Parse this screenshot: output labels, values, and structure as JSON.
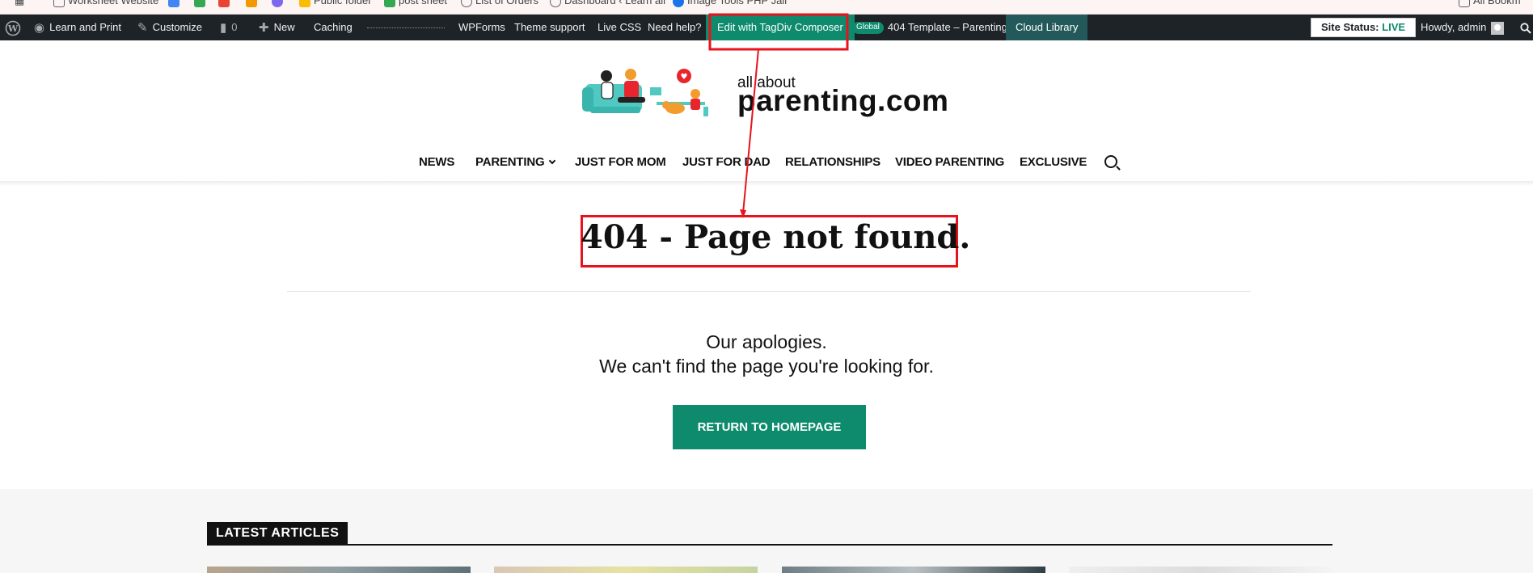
{
  "bookmarks": [
    {
      "label": "Worksheet Website",
      "color": "#5f6368"
    },
    {
      "label": "",
      "color": "#4285f4"
    },
    {
      "label": "",
      "color": "#34a853"
    },
    {
      "label": "",
      "color": "#ea4335"
    },
    {
      "label": "",
      "color": "#f29900"
    },
    {
      "label": "",
      "color": "#7b68ee"
    },
    {
      "label": "Public folder",
      "color": "#fbbc04"
    },
    {
      "label": "post sheet",
      "color": "#34a853"
    },
    {
      "label": "List of Orders",
      "color": "#5f6368"
    },
    {
      "label": "Dashboard ‹ Learn all",
      "color": "#5f6368"
    },
    {
      "label": "Image Tools PHP Jail",
      "color": "#1a73e8"
    },
    {
      "label": "All Bookm",
      "color": "#5f6368"
    }
  ],
  "adminbar": {
    "site_name": "Learn and Print",
    "customize": "Customize",
    "comments_count": "0",
    "new": "New",
    "caching": "Caching",
    "wpforms": "WPForms",
    "theme_support": "Theme support",
    "live_css": "Live CSS",
    "need_help": "Need help?",
    "edit_tagdiv": "Edit with TagDiv Composer",
    "global_badge": "Global",
    "template_name": "404 Template – Parenting",
    "cloud_library": "Cloud Library",
    "site_status_label": "Site Status:",
    "site_status_value": "LIVE",
    "howdy": "Howdy, admin"
  },
  "logo": {
    "small": "all about",
    "big": "parenting.com"
  },
  "nav": {
    "items": [
      "NEWS",
      "PARENTING",
      "JUST FOR MOM",
      "JUST FOR DAD",
      "RELATIONSHIPS",
      "VIDEO PARENTING",
      "EXCLUSIVE"
    ]
  },
  "main": {
    "title": "404 - Page not found.",
    "apology_line1": "Our apologies.",
    "apology_line2": "We can't find the page you're looking for.",
    "button": "RETURN TO HOMEPAGE"
  },
  "latest": {
    "heading": "LATEST ARTICLES"
  },
  "colors": {
    "accent": "#0e8a6d",
    "admin_bar": "#1d2327",
    "annotation": "#e8121c"
  }
}
